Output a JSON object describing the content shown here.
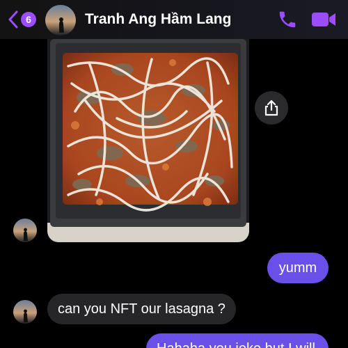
{
  "header": {
    "back_icon": "chevron-left-icon",
    "unread_count": "6",
    "contact_name": "Tranh Ang Hầm Lang",
    "call_icon": "phone-icon",
    "video_icon": "video-camera-icon",
    "accent_color": "#9b4dff"
  },
  "messages": [
    {
      "type": "photo",
      "direction": "incoming",
      "description_icon": "photo-lasagna",
      "action_icon": "share-icon"
    },
    {
      "type": "text",
      "direction": "outgoing",
      "text": "yumm"
    },
    {
      "type": "text",
      "direction": "incoming",
      "text": "can you NFT our lasagna ?"
    },
    {
      "type": "text",
      "direction": "outgoing",
      "text": "Hahaha you joke but I will"
    }
  ],
  "colors": {
    "outgoing_bubble": "#6a4fe8",
    "incoming_bubble": "#262628",
    "background": "#000000"
  }
}
